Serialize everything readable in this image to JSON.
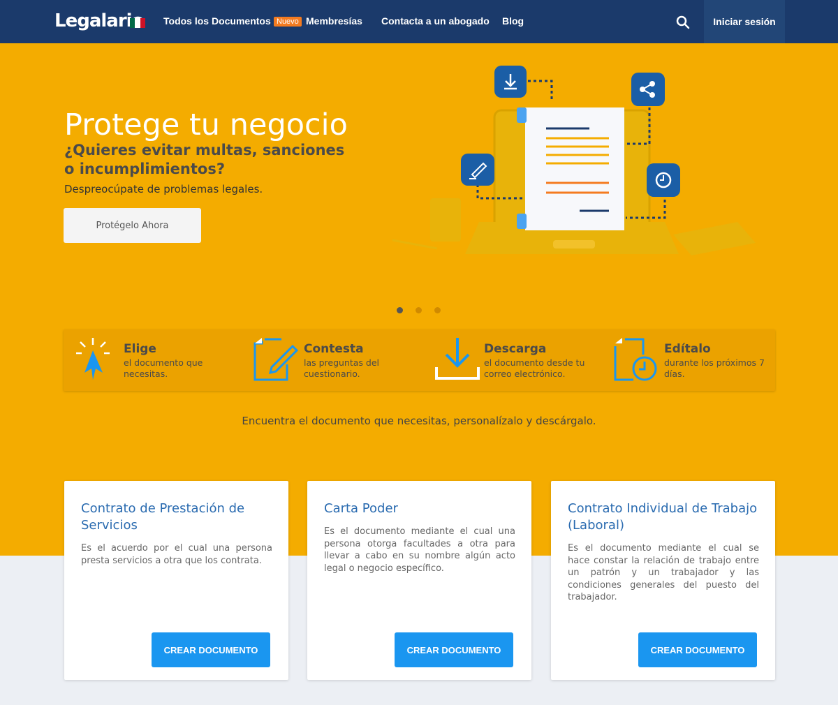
{
  "nav": {
    "logo": "Legalario",
    "links": [
      "Todos los Documentos",
      "Membresías",
      "Contacta a un abogado",
      "Blog"
    ],
    "badge": "Nuevo",
    "login": "Iniciar sesión"
  },
  "hero": {
    "title": "Protege tu negocio",
    "subtitle": "¿Quieres evitar multas, sanciones o incumplimientos?",
    "description": "Despreocúpate de problemas legales.",
    "button": "Protégelo Ahora",
    "slides": 3,
    "active_slide": 1
  },
  "steps": [
    {
      "title": "Elige",
      "desc": "el documento que necesitas."
    },
    {
      "title": "Contesta",
      "desc": "las preguntas del cuestionario."
    },
    {
      "title": "Descarga",
      "desc": "el documento desde tu correo electrónico."
    },
    {
      "title": "Edítalo",
      "desc": "durante los próximos 7 días."
    }
  ],
  "tagline": "Encuentra el documento que necesitas, personalízalo y descárgalo.",
  "cards": [
    {
      "title": "Contrato de Prestación de Servicios",
      "desc": "Es el acuerdo por el cual una persona presta servicios a otra que los contrata.",
      "button": "CREAR DOCUMENTO"
    },
    {
      "title": "Carta Poder",
      "desc": "Es el documento mediante el cual una persona otorga facultades a otra para llevar a cabo en su nombre algún acto legal o negocio específico.",
      "button": "CREAR DOCUMENTO"
    },
    {
      "title": "Contrato Individual de Trabajo (Laboral)",
      "desc": "Es el documento mediante el cual se hace constar la relación de trabajo entre un patrón y un trabajador y las condiciones generales del puesto del trabajador.",
      "button": "CREAR DOCUMENTO"
    }
  ],
  "colors": {
    "nav": "#1b3a6b",
    "hero": "#f4ac00",
    "accent": "#1a96f0",
    "badge": "#f47b20"
  }
}
